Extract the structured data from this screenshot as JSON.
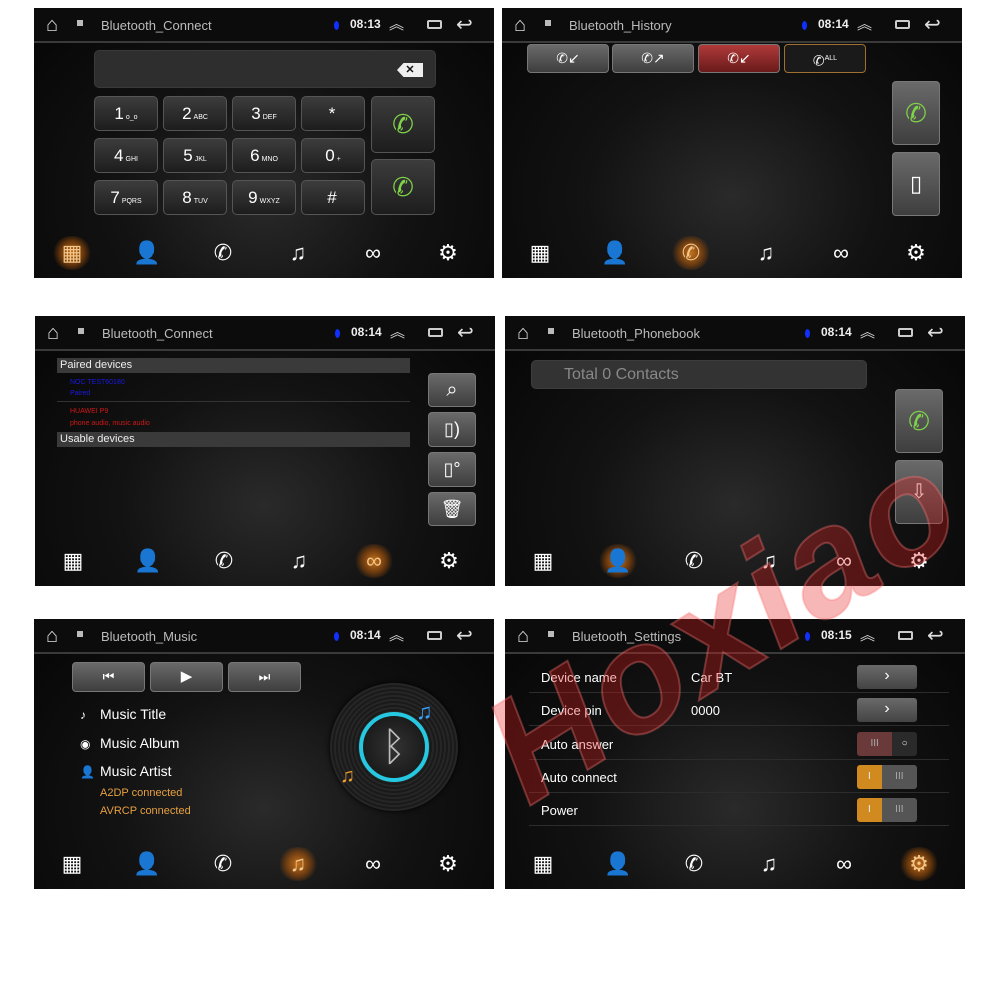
{
  "panels": [
    {
      "title": "Bluetooth_Connect",
      "time": "08:13",
      "active_nav": 0
    },
    {
      "title": "Bluetooth_History",
      "time": "08:14",
      "active_nav": 2
    },
    {
      "title": "Bluetooth_Connect",
      "time": "08:14",
      "active_nav": 4
    },
    {
      "title": "Bluetooth_Phonebook",
      "time": "08:14",
      "active_nav": 1
    },
    {
      "title": "Bluetooth_Music",
      "time": "08:14",
      "active_nav": 3
    },
    {
      "title": "Bluetooth_Settings",
      "time": "08:15",
      "active_nav": 5
    }
  ],
  "nav": [
    {
      "icon": "dialpad-icon",
      "glyph": "▦"
    },
    {
      "icon": "contacts-icon",
      "glyph": "👤"
    },
    {
      "icon": "call-history-icon",
      "glyph": "✆"
    },
    {
      "icon": "music-icon",
      "glyph": "♫"
    },
    {
      "icon": "link-icon",
      "glyph": "∞"
    },
    {
      "icon": "gear-icon",
      "glyph": "⚙"
    }
  ],
  "accent": "#c4701a",
  "dialer": {
    "keys": [
      {
        "digit": "1",
        "letters": "o_o"
      },
      {
        "digit": "2",
        "letters": "ABC"
      },
      {
        "digit": "3",
        "letters": "DEF"
      },
      {
        "digit": "*",
        "letters": ""
      },
      {
        "digit": "4",
        "letters": "GHI"
      },
      {
        "digit": "5",
        "letters": "JKL"
      },
      {
        "digit": "6",
        "letters": "MNO"
      },
      {
        "digit": "0",
        "letters": "+"
      },
      {
        "digit": "7",
        "letters": "PQRS"
      },
      {
        "digit": "8",
        "letters": "TUV"
      },
      {
        "digit": "9",
        "letters": "WXYZ"
      },
      {
        "digit": "#",
        "letters": ""
      }
    ],
    "input_value": ""
  },
  "history": {
    "tabs": [
      {
        "icon": "incoming-call-icon"
      },
      {
        "icon": "outgoing-call-icon"
      },
      {
        "icon": "missed-call-icon"
      },
      {
        "icon": "all-calls-icon",
        "label": "ALL"
      }
    ]
  },
  "connect": {
    "paired_header": "Paired devices",
    "paired": [
      {
        "name": "NOC TEST60180",
        "status": "Paired",
        "color": "#1a1adf"
      },
      {
        "name": "HUAWEI P9",
        "status": "phone audio, music audio",
        "color": "#d01818"
      }
    ],
    "usable_header": "Usable devices"
  },
  "phonebook": {
    "search_value": "Total 0 Contacts"
  },
  "music": {
    "title": "Music Title",
    "album": "Music Album",
    "artist": "Music Artist",
    "a2dp": "A2DP connected",
    "avrcp": "AVRCP connected"
  },
  "settings": {
    "rows": [
      {
        "label": "Device name",
        "value": "Car BT",
        "control": "arrow"
      },
      {
        "label": "Device pin",
        "value": "0000",
        "control": "arrow"
      },
      {
        "label": "Auto answer",
        "control": "toggle",
        "on": false
      },
      {
        "label": "Auto connect",
        "control": "toggle",
        "on": true
      },
      {
        "label": "Power",
        "control": "toggle",
        "on": true
      }
    ]
  },
  "watermark": "Hoxiao"
}
